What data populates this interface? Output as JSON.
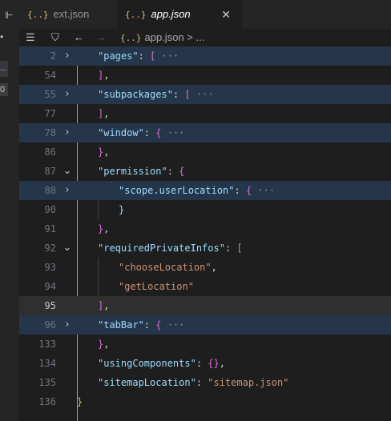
{
  "tabs": [
    {
      "icon": "{..}",
      "label": "ext.json"
    },
    {
      "icon": "{..}",
      "label": "app.json",
      "close": "✕"
    }
  ],
  "left_strip": {
    "more": "...",
    "badge": "0"
  },
  "breadcrumb": {
    "icon": "{..}",
    "file": "app.json",
    "sep": ">",
    "rest": "..."
  },
  "lines": [
    {
      "n": "2",
      "fold": "›",
      "indent": 0,
      "tokens": [
        [
          "key",
          "\"pages\""
        ],
        [
          "p",
          ": "
        ],
        [
          "bb",
          "["
        ],
        [
          "f",
          " ···"
        ]
      ]
    },
    {
      "n": "54",
      "fold": "",
      "indent": 0,
      "tokens": [
        [
          "bb",
          "]"
        ],
        [
          "p",
          ","
        ]
      ]
    },
    {
      "n": "55",
      "fold": "›",
      "indent": 0,
      "tokens": [
        [
          "key",
          "\"subpackages\""
        ],
        [
          "p",
          ": "
        ],
        [
          "bb",
          "["
        ],
        [
          "f",
          " ···"
        ]
      ]
    },
    {
      "n": "77",
      "fold": "",
      "indent": 0,
      "tokens": [
        [
          "bb",
          "]"
        ],
        [
          "p",
          ","
        ]
      ]
    },
    {
      "n": "78",
      "fold": "›",
      "indent": 0,
      "tokens": [
        [
          "key",
          "\"window\""
        ],
        [
          "p",
          ": "
        ],
        [
          "bf",
          "{"
        ],
        [
          "f",
          " ···"
        ]
      ]
    },
    {
      "n": "86",
      "fold": "",
      "indent": 0,
      "tokens": [
        [
          "bf",
          "}"
        ],
        [
          "p",
          ","
        ]
      ]
    },
    {
      "n": "87",
      "fold": "⌄",
      "indent": 0,
      "tokens": [
        [
          "key",
          "\"permission\""
        ],
        [
          "p",
          ": "
        ],
        [
          "bf",
          "{"
        ]
      ]
    },
    {
      "n": "88",
      "fold": "›",
      "indent": 1,
      "tokens": [
        [
          "key",
          "\"scope.userLocation\""
        ],
        [
          "p",
          ": "
        ],
        [
          "bf",
          "{"
        ],
        [
          "f",
          " ···"
        ]
      ]
    },
    {
      "n": "90",
      "fold": "",
      "indent": 1,
      "tokens": [
        [
          "key",
          "}"
        ]
      ]
    },
    {
      "n": "91",
      "fold": "",
      "indent": 0,
      "tokens": [
        [
          "bf",
          "}"
        ],
        [
          "p",
          ","
        ]
      ]
    },
    {
      "n": "92",
      "fold": "⌄",
      "indent": 0,
      "tokens": [
        [
          "key",
          "\"requiredPrivateInfos\""
        ],
        [
          "p",
          ": "
        ],
        [
          "bb",
          "["
        ]
      ]
    },
    {
      "n": "93",
      "fold": "",
      "indent": 1,
      "tokens": [
        [
          "str",
          "\"chooseLocation\""
        ],
        [
          "p",
          ","
        ]
      ]
    },
    {
      "n": "94",
      "fold": "",
      "indent": 1,
      "tokens": [
        [
          "str",
          "\"getLocation\""
        ]
      ]
    },
    {
      "n": "95",
      "fold": "",
      "indent": 0,
      "tokens": [
        [
          "bb",
          "]"
        ],
        [
          "p",
          ","
        ]
      ]
    },
    {
      "n": "96",
      "fold": "›",
      "indent": 0,
      "tokens": [
        [
          "key",
          "\"tabBar\""
        ],
        [
          "p",
          ": "
        ],
        [
          "bf",
          "{"
        ],
        [
          "f",
          " ···"
        ]
      ]
    },
    {
      "n": "133",
      "fold": "",
      "indent": 0,
      "tokens": [
        [
          "bf",
          "}"
        ],
        [
          "p",
          ","
        ]
      ]
    },
    {
      "n": "134",
      "fold": "",
      "indent": 0,
      "tokens": [
        [
          "key",
          "\"usingComponents\""
        ],
        [
          "p",
          ": "
        ],
        [
          "bf",
          "{}"
        ],
        [
          "p",
          ","
        ]
      ]
    },
    {
      "n": "135",
      "fold": "",
      "indent": 0,
      "tokens": [
        [
          "key",
          "\"sitemapLocation\""
        ],
        [
          "p",
          ": "
        ],
        [
          "str",
          "\"sitemap.json\""
        ]
      ]
    },
    {
      "n": "136",
      "fold": "",
      "indent": 0,
      "tokens": [],
      "closing": "}"
    }
  ],
  "highlighted_lines": [
    "2",
    "55",
    "78",
    "88",
    "96"
  ],
  "current_line": "95",
  "colors": {
    "key": "#9cdcfe",
    "string": "#ce9178",
    "bracket": "#da70d6",
    "line_highlight": "#25364a"
  }
}
